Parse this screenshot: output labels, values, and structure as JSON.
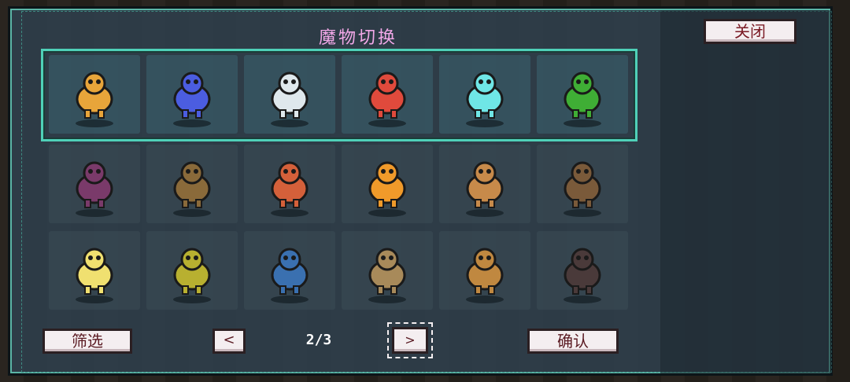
{
  "dialog": {
    "title": "魔物切换",
    "close_label": "关闭"
  },
  "party": [
    {
      "name": "owl-monster-icon",
      "color": "#e8a53a"
    },
    {
      "name": "blue-slime-icon",
      "color": "#4b5de0"
    },
    {
      "name": "white-unicorn-icon",
      "color": "#dfe8ec"
    },
    {
      "name": "parrot-bird-icon",
      "color": "#e04a3c"
    },
    {
      "name": "ice-ghost-icon",
      "color": "#6fe6e6"
    },
    {
      "name": "mantis-icon",
      "color": "#3fae35"
    }
  ],
  "storage": [
    {
      "name": "purple-bat-icon",
      "color": "#7a3a6a"
    },
    {
      "name": "hooded-monk-icon",
      "color": "#8a6a3a"
    },
    {
      "name": "mushroom-icon",
      "color": "#d4603a"
    },
    {
      "name": "orange-tiger-icon",
      "color": "#f09a2a"
    },
    {
      "name": "mandrake-root-icon",
      "color": "#c78a4a"
    },
    {
      "name": "tanuki-icon",
      "color": "#7a5a3a"
    },
    {
      "name": "firefly-orb-icon",
      "color": "#f0e070"
    },
    {
      "name": "lizard-spearman-icon",
      "color": "#b8b030"
    },
    {
      "name": "blue-samurai-icon",
      "color": "#3a70b0"
    },
    {
      "name": "sprout-bulb-icon",
      "color": "#a88a5a"
    },
    {
      "name": "winged-dragon-icon",
      "color": "#c08840"
    },
    {
      "name": "dark-bat-icon",
      "color": "#4a3a3a"
    }
  ],
  "footer": {
    "filter_label": "筛选",
    "prev_label": "<",
    "page": "2/3",
    "next_label": ">",
    "confirm_label": "确认"
  }
}
